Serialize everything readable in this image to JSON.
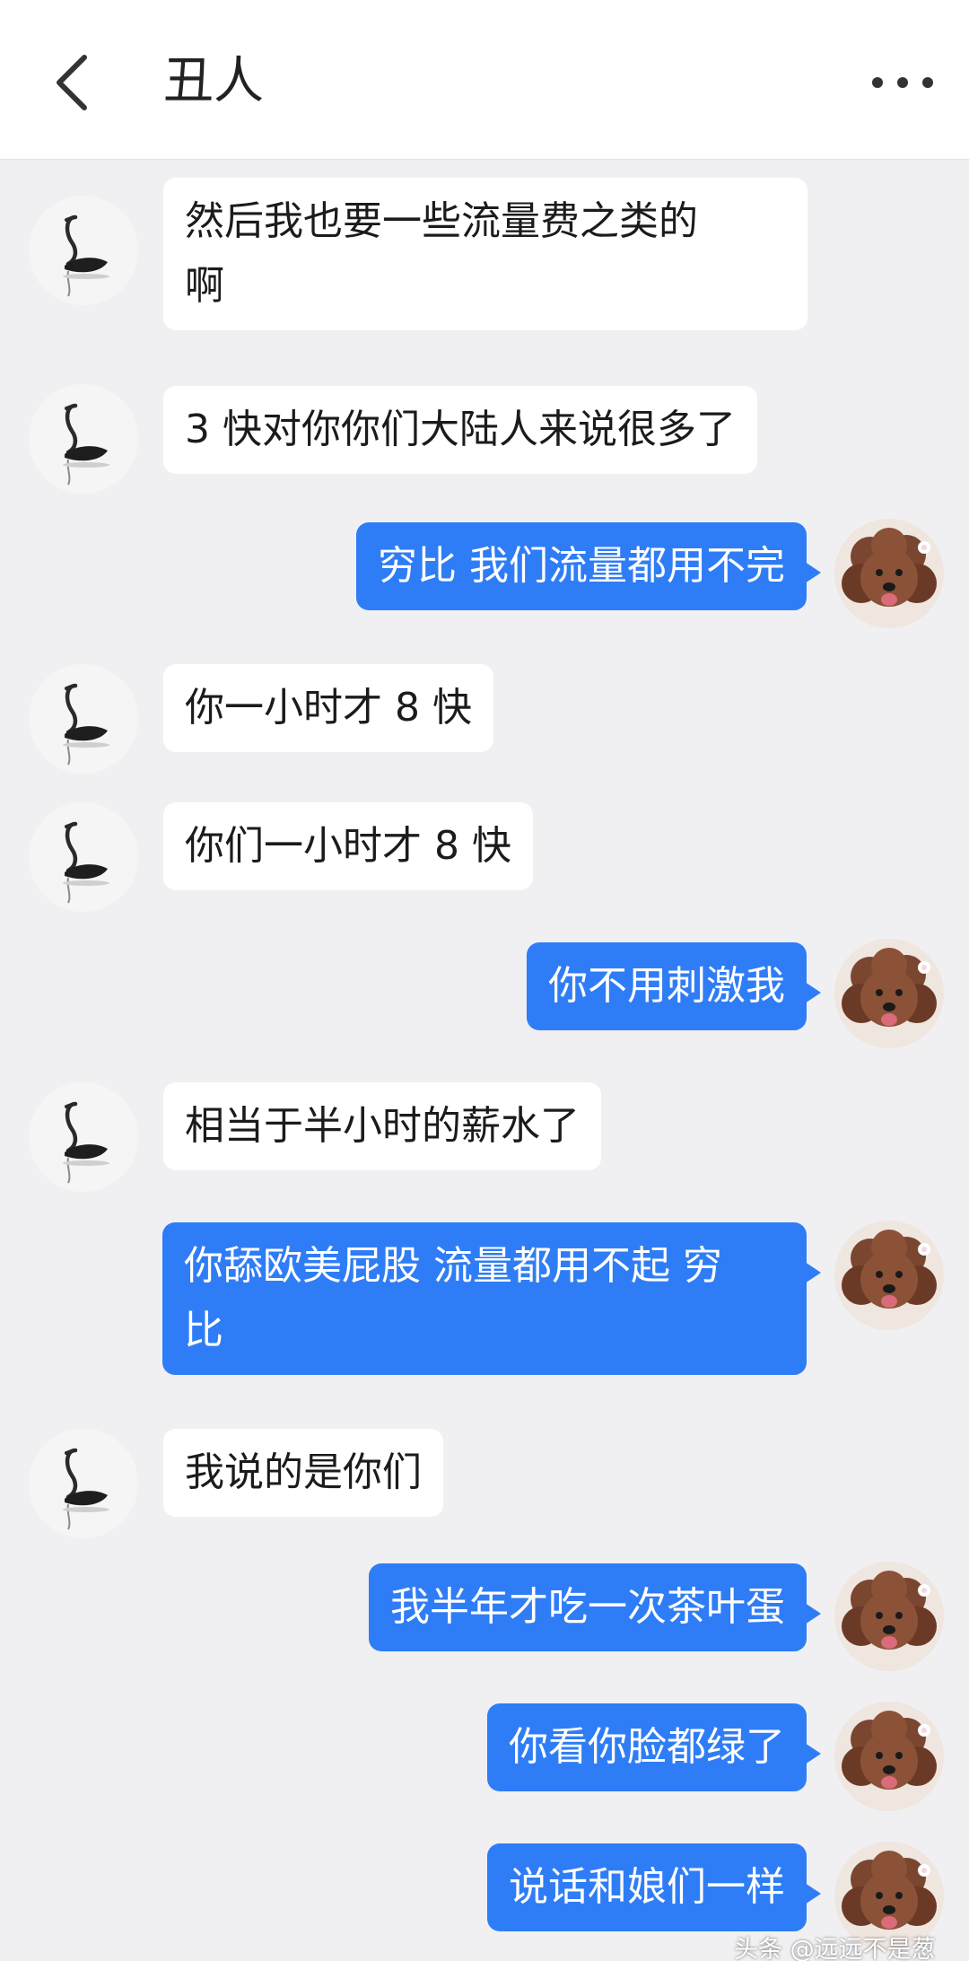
{
  "header": {
    "title": "丑人",
    "back_icon": "chevron-left-icon",
    "more_icon": "more-horizontal-icon"
  },
  "colors": {
    "outgoing_bubble": "#2f7df6",
    "incoming_bubble": "#ffffff",
    "background": "#f0f0f2"
  },
  "messages": [
    {
      "side": "in",
      "text": "然后我也要一些流量费之类的\n啊"
    },
    {
      "side": "in",
      "text": "3 快对你你们大陆人来说很多了"
    },
    {
      "side": "out",
      "text": "穷比 我们流量都用不完"
    },
    {
      "side": "in",
      "text": "你一小时才 8 快"
    },
    {
      "side": "in",
      "text": "你们一小时才 8 快"
    },
    {
      "side": "out",
      "text": "你不用刺激我"
    },
    {
      "side": "in",
      "text": "相当于半小时的薪水了"
    },
    {
      "side": "out",
      "text": "你舔欧美屁股 流量都用不起 穷\n比"
    },
    {
      "side": "in",
      "text": "我说的是你们"
    },
    {
      "side": "out",
      "text": "我半年才吃一次茶叶蛋"
    },
    {
      "side": "out",
      "text": "你看你脸都绿了"
    },
    {
      "side": "out",
      "text": "说话和娘们一样"
    }
  ],
  "watermark": "头条 @远远不是葱"
}
